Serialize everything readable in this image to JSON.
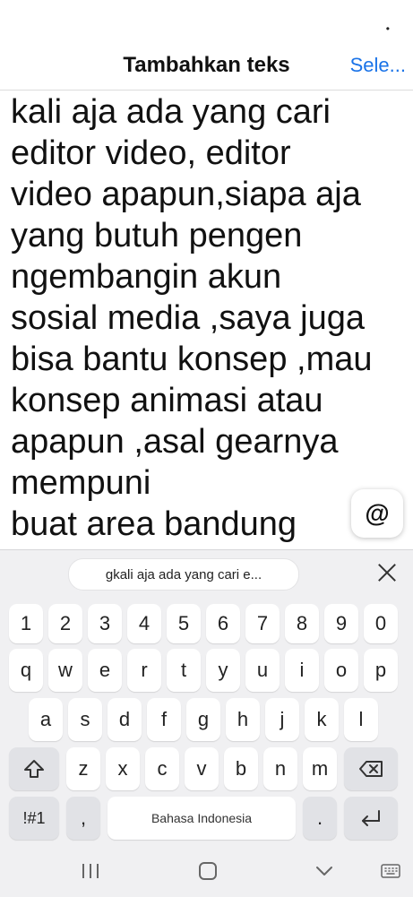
{
  "status_bar": {
    "dot": "•"
  },
  "header": {
    "title": "Tambahkan teks",
    "action_label": "Sele..."
  },
  "editor": {
    "lines": [
      "kali aja ada yang cari",
      "editor video, editor",
      "video apapun,siapa aja",
      "yang butuh pengen",
      "ngembangin akun",
      "sosial media ,saya juga",
      "bisa bantu konsep ,mau",
      "konsep animasi atau",
      "apapun ,asal gearnya",
      "mempuni",
      "buat area bandung"
    ]
  },
  "mention_button": {
    "label": "@"
  },
  "keyboard": {
    "suggestion": "gkali aja ada yang cari e...",
    "row_numbers": [
      "1",
      "2",
      "3",
      "4",
      "5",
      "6",
      "7",
      "8",
      "9",
      "0"
    ],
    "row_top": [
      "q",
      "w",
      "e",
      "r",
      "t",
      "y",
      "u",
      "i",
      "o",
      "p"
    ],
    "row_middle": [
      "a",
      "s",
      "d",
      "f",
      "g",
      "h",
      "j",
      "k",
      "l"
    ],
    "row_bottom": [
      "z",
      "x",
      "c",
      "v",
      "b",
      "n",
      "m"
    ],
    "symbols_label": "!#1",
    "comma_label": ",",
    "space_label": "Bahasa Indonesia",
    "period_label": "."
  },
  "colors": {
    "accent": "#1a73e8",
    "keyboard_bg": "#f0f0f2"
  },
  "icons": {
    "shift": "shift-icon",
    "backspace": "backspace-icon",
    "enter": "enter-icon",
    "close": "close-icon",
    "recents": "recents-icon",
    "home": "home-icon",
    "back": "back-icon",
    "keyboard": "keyboard-icon"
  }
}
